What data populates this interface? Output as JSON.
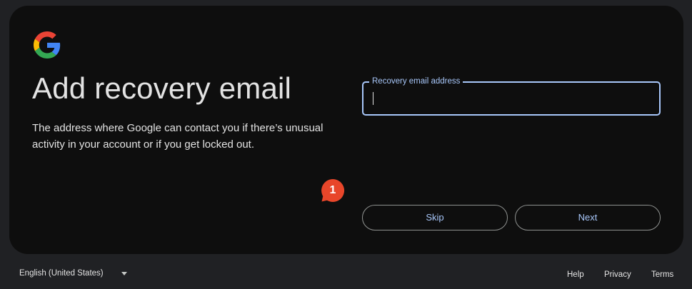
{
  "brand": {
    "logo_icon": "google-g-logo",
    "colors": {
      "blue": "#4285F4",
      "red": "#EA4335",
      "yellow": "#FBBC05",
      "green": "#34A853"
    }
  },
  "main": {
    "title": "Add recovery email",
    "description": "The address where Google can contact you if there’s unusual activity in your account or if you get locked out."
  },
  "form": {
    "recovery_email": {
      "label": "Recovery email address",
      "value": "",
      "focused": true
    }
  },
  "actions": {
    "skip_label": "Skip",
    "next_label": "Next"
  },
  "annotation": {
    "step_number": "1",
    "color": "#e8462a"
  },
  "footer": {
    "language": "English (United States)",
    "links": {
      "help": "Help",
      "privacy": "Privacy",
      "terms": "Terms"
    }
  },
  "theme": {
    "page_bg": "#202124",
    "card_bg": "#0e0e0e",
    "accent": "#a8c7fa",
    "text": "#e3e3e3"
  }
}
